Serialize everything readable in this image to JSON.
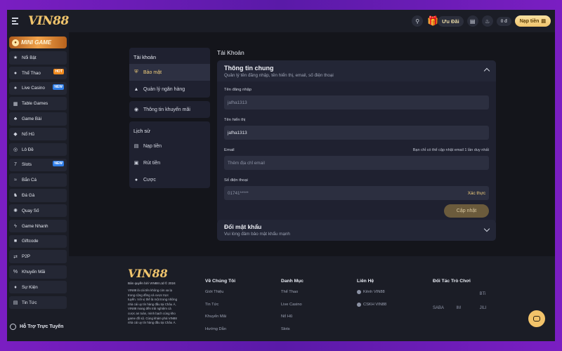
{
  "header": {
    "logo": "VIN88",
    "promo_label": "Ưu Đãi",
    "balance": "0 đ",
    "deposit_label": "Nạp tiền"
  },
  "sidebar": {
    "mini_game": "MINI GAME",
    "items": [
      {
        "label": "Nổi Bật",
        "icon": "star-icon"
      },
      {
        "label": "Thể Thao",
        "icon": "soccer-icon",
        "badge": "HOT"
      },
      {
        "label": "Live Casino",
        "icon": "casino-icon",
        "badge": "NEW"
      },
      {
        "label": "Table Games",
        "icon": "table-icon"
      },
      {
        "label": "Game Bài",
        "icon": "cards-icon"
      },
      {
        "label": "Nổ Hũ",
        "icon": "jackpot-icon"
      },
      {
        "label": "Lô Đề",
        "icon": "lottery-icon"
      },
      {
        "label": "Slots",
        "icon": "slots-icon",
        "badge": "NEW"
      },
      {
        "label": "Bắn Cá",
        "icon": "fish-icon"
      },
      {
        "label": "Đá Gà",
        "icon": "rooster-icon"
      },
      {
        "label": "Quay Số",
        "icon": "wheel-icon"
      },
      {
        "label": "Game Nhanh",
        "icon": "bolt-icon"
      },
      {
        "label": "Giftcode",
        "icon": "gift-icon"
      },
      {
        "label": "P2P",
        "icon": "p2p-icon"
      },
      {
        "label": "Khuyến Mãi",
        "icon": "promo-icon"
      },
      {
        "label": "Sự Kiện",
        "icon": "event-icon"
      },
      {
        "label": "Tin Tức",
        "icon": "news-icon"
      }
    ],
    "support": "Hỗ Trợ Trực Tuyến"
  },
  "account_menu": {
    "account_title": "Tài khoản",
    "security": "Bảo mật",
    "bank": "Quản lý ngân hàng",
    "promo_info": "Thông tin khuyến mãi",
    "history_title": "Lịch sử",
    "deposit": "Nạp tiền",
    "withdraw": "Rút tiền",
    "bets": "Cược"
  },
  "main": {
    "title": "Tài Khoản",
    "general": {
      "title": "Thông tin chung",
      "subtitle": "Quản lý tên đăng nhập, tên hiển thị, email, số điện thoại",
      "username_label": "Tên đăng nhập",
      "username_value": "jafha1313",
      "display_label": "Tên hiển thị",
      "display_value": "jafha1313",
      "email_label": "Email",
      "email_note": "Bạn chỉ có thể cập nhật email 1 lần duy nhất",
      "email_placeholder": "Thêm địa chỉ email",
      "phone_label": "Số điện thoại",
      "phone_value": "01741*****",
      "verify": "Xác thực",
      "update_button": "Cập nhật"
    },
    "password": {
      "title": "Đổi mật khẩu",
      "subtitle": "Vui lòng đảm bảo mật khẩu mạnh"
    }
  },
  "footer": {
    "logo": "VIN88",
    "copyright": "Bản quyền bởi VIN88 Ltd © 2024",
    "description": "VIN88 là cái tên không còn xa lạ trong cộng đồng cá cược trực tuyến. Với vị thế là một trong những nhà cái uy tín hàng đầu tại Châu Á, VIN88 mang đến trải nghiệm cá cược an toàn, minh bạch cùng kho game đồ sộ. Cùng khám phá VIN88 nhà cái uy tín hàng đầu tại Châu Á.",
    "about": {
      "title": "Về Chúng Tôi",
      "links": [
        "Giới Thiệu",
        "Tin Tức",
        "Khuyến Mãi",
        "Hướng Dẫn"
      ]
    },
    "categories": {
      "title": "Danh Mục",
      "links": [
        "Thể Thao",
        "Live Casino",
        "Nổ Hũ",
        "Slots"
      ]
    },
    "contact": {
      "title": "Liên Hệ",
      "links": [
        "Kênh VIN88",
        "CSKH VIN88"
      ]
    },
    "partners": {
      "title": "Đối Tác Trò Chơi",
      "logos": [
        "",
        "",
        "BTi",
        "SABA",
        "IM",
        "JILI"
      ]
    }
  }
}
